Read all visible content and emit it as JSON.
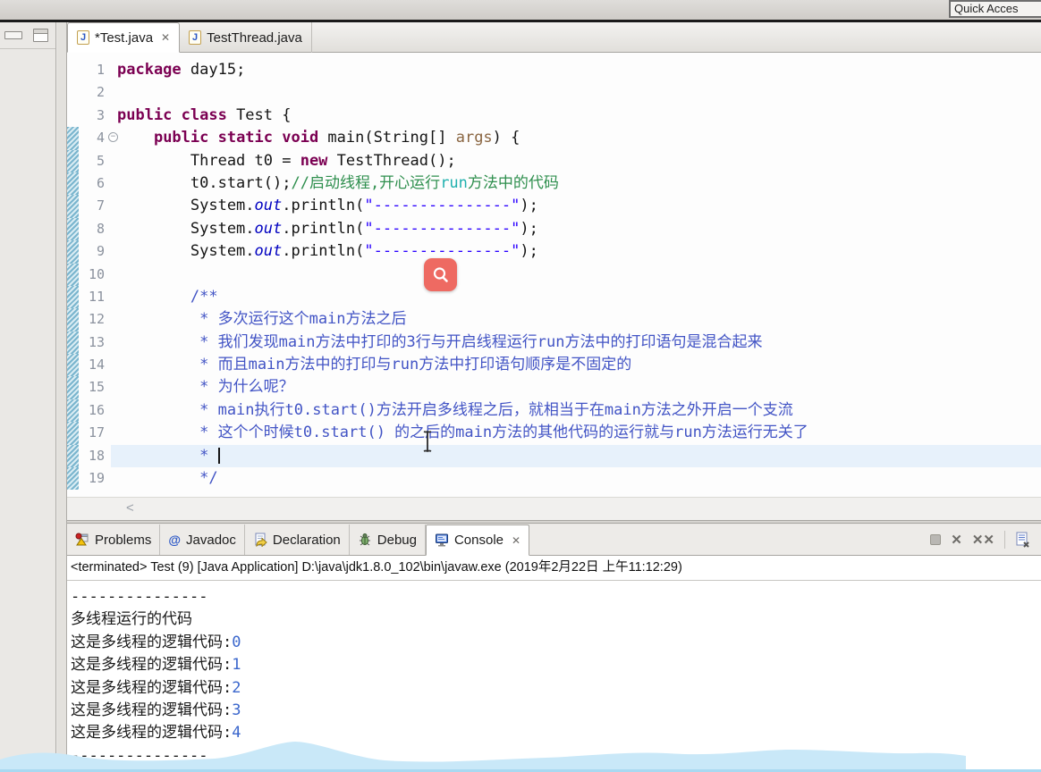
{
  "window": {
    "quick_access_label": "Quick Acces"
  },
  "left_rail": {
    "icons": [
      "minimize-icon",
      "restore-icon"
    ]
  },
  "editor": {
    "tabs": [
      {
        "label": "*Test.java",
        "active": true,
        "closable": true,
        "icon": "java-file-icon",
        "close_glyph": "✕"
      },
      {
        "label": "TestThread.java",
        "active": false,
        "closable": false,
        "icon": "java-file-icon"
      }
    ],
    "hscroll_hint": "<",
    "lines": [
      {
        "n": "1",
        "segments": [
          {
            "t": "package",
            "c": "kw"
          },
          {
            "t": " day15;",
            "c": "pl"
          }
        ]
      },
      {
        "n": "2",
        "segments": []
      },
      {
        "n": "3",
        "segments": [
          {
            "t": "public class",
            "c": "kw"
          },
          {
            "t": " Test {",
            "c": "pl"
          }
        ]
      },
      {
        "n": "4",
        "fold": true,
        "segments": [
          {
            "t": "    ",
            "c": "pl"
          },
          {
            "t": "public static void",
            "c": "kw"
          },
          {
            "t": " main(String[] ",
            "c": "pl"
          },
          {
            "t": "args",
            "c": "param"
          },
          {
            "t": ") {",
            "c": "pl"
          }
        ]
      },
      {
        "n": "5",
        "segments": [
          {
            "t": "        Thread t0 = ",
            "c": "pl"
          },
          {
            "t": "new",
            "c": "kw"
          },
          {
            "t": " TestThread();",
            "c": "pl"
          }
        ]
      },
      {
        "n": "6",
        "segments": [
          {
            "t": "        t0.start();",
            "c": "pl"
          },
          {
            "t": "//启动线程,开心运行",
            "c": "cmt"
          },
          {
            "t": "run",
            "c": "cmt2"
          },
          {
            "t": "方法中的代码",
            "c": "cmt"
          }
        ]
      },
      {
        "n": "7",
        "segments": [
          {
            "t": "        System.",
            "c": "pl"
          },
          {
            "t": "out",
            "c": "field"
          },
          {
            "t": ".println(",
            "c": "pl"
          },
          {
            "t": "\"---------------\"",
            "c": "str"
          },
          {
            "t": ");",
            "c": "pl"
          }
        ]
      },
      {
        "n": "8",
        "segments": [
          {
            "t": "        System.",
            "c": "pl"
          },
          {
            "t": "out",
            "c": "field"
          },
          {
            "t": ".println(",
            "c": "pl"
          },
          {
            "t": "\"---------------\"",
            "c": "str"
          },
          {
            "t": ");",
            "c": "pl"
          }
        ]
      },
      {
        "n": "9",
        "segments": [
          {
            "t": "        System.",
            "c": "pl"
          },
          {
            "t": "out",
            "c": "field"
          },
          {
            "t": ".println(",
            "c": "pl"
          },
          {
            "t": "\"---------------\"",
            "c": "str"
          },
          {
            "t": ");",
            "c": "pl"
          }
        ]
      },
      {
        "n": "10",
        "segments": []
      },
      {
        "n": "11",
        "segments": [
          {
            "t": "        /**",
            "c": "doc"
          }
        ]
      },
      {
        "n": "12",
        "segments": [
          {
            "t": "         * 多次运行这个main方法之后",
            "c": "doc"
          }
        ]
      },
      {
        "n": "13",
        "segments": [
          {
            "t": "         * 我们发现main方法中打印的3行与开启线程运行run方法中的打印语句是混合起来",
            "c": "doc"
          }
        ]
      },
      {
        "n": "14",
        "segments": [
          {
            "t": "         * 而且main方法中的打印与run方法中打印语句顺序是不固定的",
            "c": "doc"
          }
        ]
      },
      {
        "n": "15",
        "segments": [
          {
            "t": "         * 为什么呢？",
            "c": "doc"
          }
        ]
      },
      {
        "n": "16",
        "segments": [
          {
            "t": "         * main执行t0.start()方法开启多线程之后，就相当于在main方法之外开启一个支流",
            "c": "doc"
          }
        ]
      },
      {
        "n": "17",
        "segments": [
          {
            "t": "         * 这个个时候t0.start() 的之后的main方法的其他代码的运行就与run方法运行无关了",
            "c": "doc"
          }
        ]
      },
      {
        "n": "18",
        "current": true,
        "caret": true,
        "segments": [
          {
            "t": "         * ",
            "c": "doc"
          }
        ]
      },
      {
        "n": "19",
        "segments": [
          {
            "t": "         */",
            "c": "doc"
          }
        ]
      }
    ]
  },
  "console_panel": {
    "tabs": [
      {
        "label": "Problems",
        "icon": "problems-icon",
        "active": false
      },
      {
        "label": "Javadoc",
        "icon": "javadoc-icon",
        "active": false
      },
      {
        "label": "Declaration",
        "icon": "declaration-icon",
        "active": false
      },
      {
        "label": "Debug",
        "icon": "debug-icon",
        "active": false
      },
      {
        "label": "Console",
        "icon": "console-icon",
        "active": true,
        "closable": true,
        "close_glyph": "✕"
      }
    ],
    "toolbar": {
      "remove_glyph": "✕",
      "remove_all_glyph": "✕✕"
    },
    "status": "<terminated> Test (9) [Java Application] D:\\java\\jdk1.8.0_102\\bin\\javaw.exe (2019年2月22日 上午11:12:29)",
    "output": [
      {
        "segments": [
          {
            "t": "---------------",
            "c": "out"
          }
        ]
      },
      {
        "segments": [
          {
            "t": "多线程运行的代码",
            "c": "out"
          }
        ]
      },
      {
        "segments": [
          {
            "t": "这是多线程的逻辑代码:",
            "c": "out"
          },
          {
            "t": "0",
            "c": "numb"
          }
        ]
      },
      {
        "segments": [
          {
            "t": "这是多线程的逻辑代码:",
            "c": "out"
          },
          {
            "t": "1",
            "c": "numb"
          }
        ]
      },
      {
        "segments": [
          {
            "t": "这是多线程的逻辑代码:",
            "c": "out"
          },
          {
            "t": "2",
            "c": "numb"
          }
        ]
      },
      {
        "segments": [
          {
            "t": "这是多线程的逻辑代码:",
            "c": "out"
          },
          {
            "t": "3",
            "c": "numb"
          }
        ]
      },
      {
        "segments": [
          {
            "t": "这是多线程的逻辑代码:",
            "c": "out"
          },
          {
            "t": "4",
            "c": "numb"
          }
        ]
      },
      {
        "segments": [
          {
            "t": "---------------",
            "c": "out"
          }
        ]
      }
    ]
  },
  "colors": {
    "keyword": "#7b0052",
    "string": "#2a00ff",
    "comment": "#2f8f4e",
    "comment_run": "#1fb0ae",
    "javadoc": "#4254c5",
    "field": "#0000c0",
    "console_number": "#3a66cc",
    "magnifier_badge": "#ee6a62",
    "wave": "#c9e8f8",
    "current_line": "#e7f1fb"
  }
}
